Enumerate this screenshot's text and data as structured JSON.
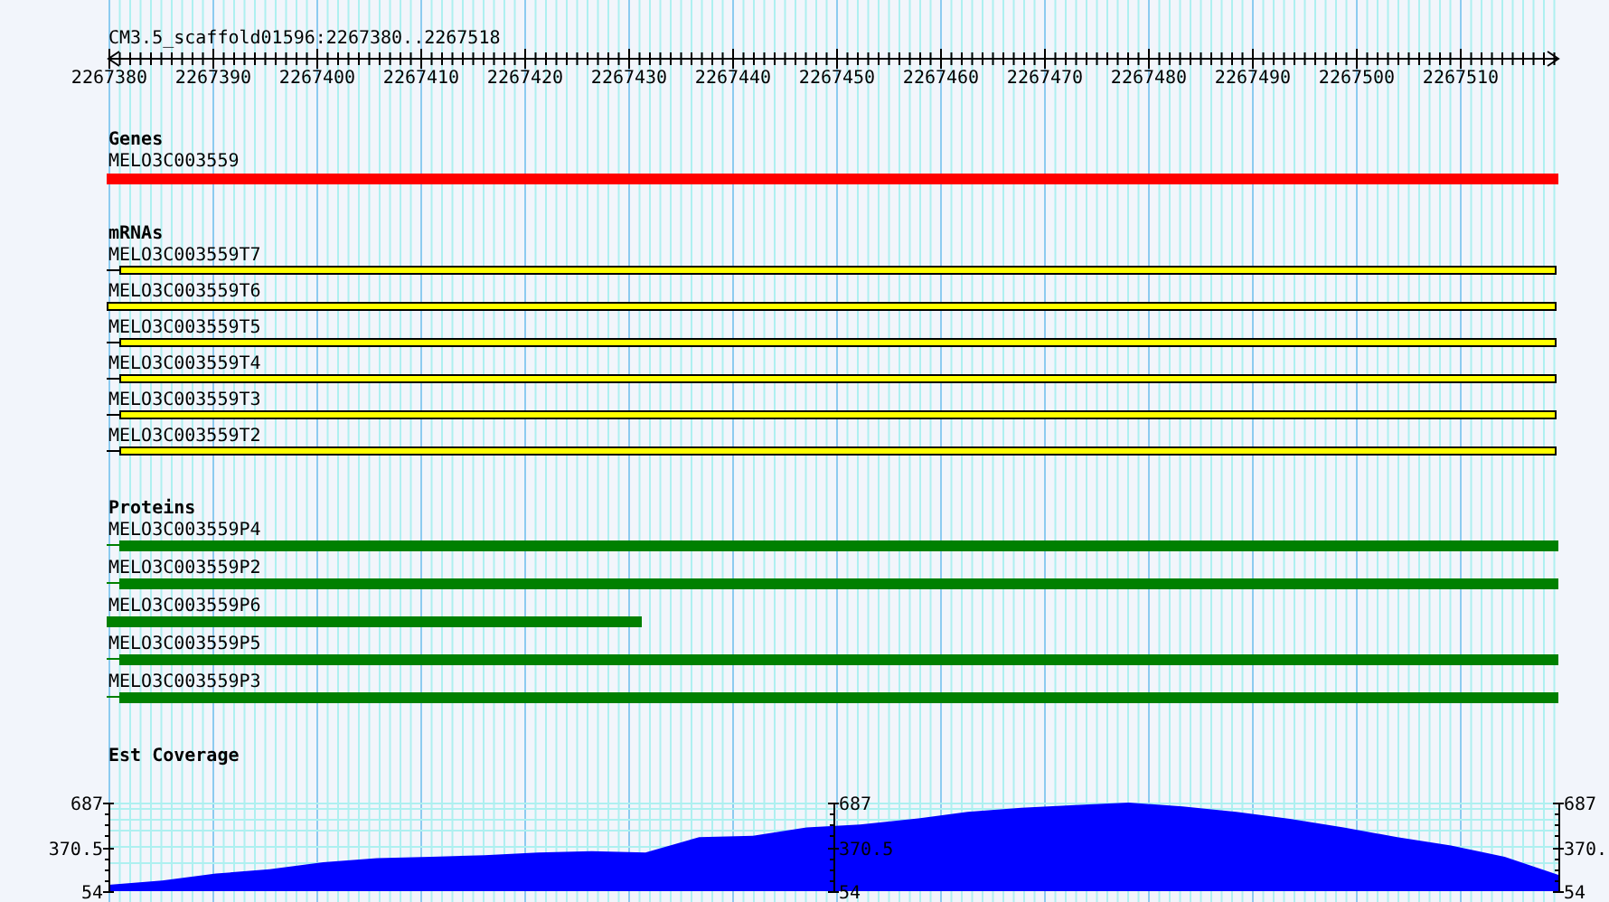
{
  "title": "CM3.5_scaffold01596:2267380..2267518",
  "ruler": {
    "labels": [
      "2267380",
      "2267390",
      "2267400",
      "2267410",
      "2267420",
      "2267430",
      "2267440",
      "2267450",
      "2267460",
      "2267470",
      "2267480",
      "2267490",
      "2267500",
      "2267510"
    ]
  },
  "tracks": [
    {
      "heading": "Genes",
      "kind": "gene",
      "features": [
        {
          "name": "MELO3C003559",
          "leader": false,
          "truncated": false
        }
      ]
    },
    {
      "heading": "mRNAs",
      "kind": "mrna",
      "features": [
        {
          "name": "MELO3C003559T7",
          "leader": true,
          "truncated": false
        },
        {
          "name": "MELO3C003559T6",
          "leader": false,
          "truncated": false
        },
        {
          "name": "MELO3C003559T5",
          "leader": true,
          "truncated": false
        },
        {
          "name": "MELO3C003559T4",
          "leader": true,
          "truncated": false
        },
        {
          "name": "MELO3C003559T3",
          "leader": true,
          "truncated": false
        },
        {
          "name": "MELO3C003559T2",
          "leader": true,
          "truncated": false
        }
      ]
    },
    {
      "heading": "Proteins",
      "kind": "protein",
      "features": [
        {
          "name": "MELO3C003559P4",
          "leader": true,
          "truncated": false
        },
        {
          "name": "MELO3C003559P2",
          "leader": true,
          "truncated": false
        },
        {
          "name": "MELO3C003559P6",
          "leader": false,
          "truncated": true
        },
        {
          "name": "MELO3C003559P5",
          "leader": true,
          "truncated": false
        },
        {
          "name": "MELO3C003559P3",
          "leader": true,
          "truncated": false
        }
      ]
    }
  ],
  "coverage": {
    "y_axes": [
      {
        "labels": [
          "687",
          "370.5",
          "54"
        ]
      },
      {
        "labels": [
          "687",
          "370.5",
          "54"
        ]
      },
      {
        "labels": [
          "687",
          "370.",
          "54"
        ]
      }
    ],
    "chart_data": {
      "type": "area",
      "series": [
        {
          "name": "Est Coverage",
          "color": "#0000ff",
          "values": [
            100,
            130,
            180,
            210,
            260,
            290,
            300,
            310,
            330,
            340,
            330,
            440,
            450,
            510,
            530,
            570,
            620,
            650,
            670,
            687,
            660,
            620,
            570,
            510,
            440,
            380,
            300,
            170
          ]
        }
      ],
      "ylim": [
        54,
        687
      ],
      "yticks": [
        687,
        370.5,
        54
      ]
    }
  }
}
